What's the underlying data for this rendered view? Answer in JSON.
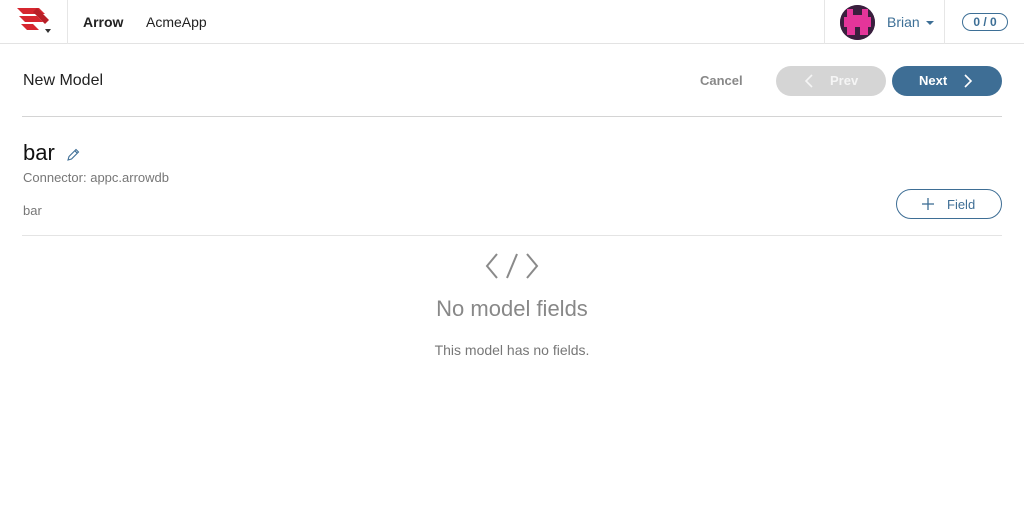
{
  "nav": {
    "logo_icon": "arrow-wings-logo-icon",
    "primary": "Arrow",
    "app": "AcmeApp",
    "user": "Brian",
    "counter": "0 / 0"
  },
  "header": {
    "title": "New Model",
    "cancel": "Cancel",
    "prev": "Prev",
    "next": "Next"
  },
  "model": {
    "name": "bar",
    "connector_label": "Connector:",
    "connector_value": "appc.arrowdb",
    "description": "bar",
    "add_field": "Field"
  },
  "empty_state": {
    "icon": "code-brackets-icon",
    "title": "No model fields",
    "subtitle": "This model has no fields."
  },
  "colors": {
    "accent": "#3e6e95",
    "logo_red": "#d6262f",
    "disabled": "#d5d5d5",
    "avatar_pink": "#e4359a"
  }
}
